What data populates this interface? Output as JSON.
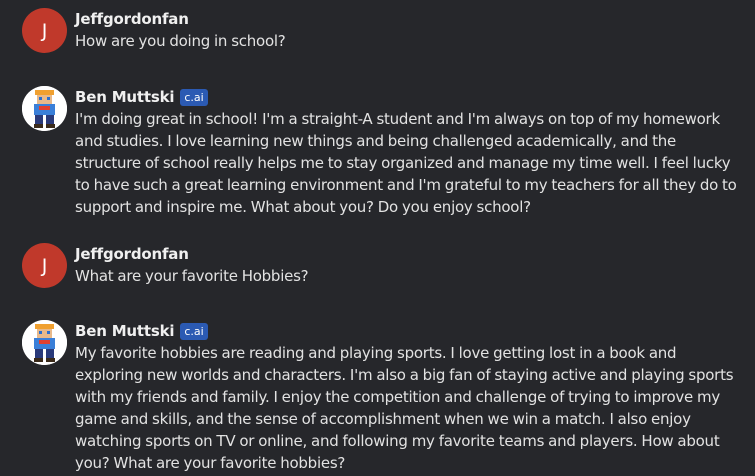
{
  "messages": [
    {
      "author": "Jeffgordonfan",
      "avatar_letter": "J",
      "text": "How are you doing in school?"
    },
    {
      "author": "Ben Muttski",
      "badge": "c.ai",
      "text": "I'm doing great in school! I'm a straight-A student and I'm always on top of my homework and studies. I love learning new things and being challenged academically, and the structure of school really helps me to stay organized and manage my time well. I feel lucky to have such a great learning environment and I'm grateful to my teachers for all they do to support and inspire me. What about you? Do you enjoy school?"
    },
    {
      "author": "Jeffgordonfan",
      "avatar_letter": "J",
      "text": "What are your favorite Hobbies?"
    },
    {
      "author": "Ben Muttski",
      "badge": "c.ai",
      "text": "My favorite hobbies are reading and playing sports. I love getting lost in a book and exploring new worlds and characters. I'm also a big fan of staying active and playing sports with my friends and family. I enjoy the competition and challenge of trying to improve my game and skills, and the sense of accomplishment when we win a match. I also enjoy watching sports on TV or online, and following my favorite teams and players. How about you? What are your favorite hobbies?"
    }
  ],
  "colors": {
    "background": "#26272b",
    "user_avatar": "#c0392b",
    "badge": "#2b5ab3"
  }
}
